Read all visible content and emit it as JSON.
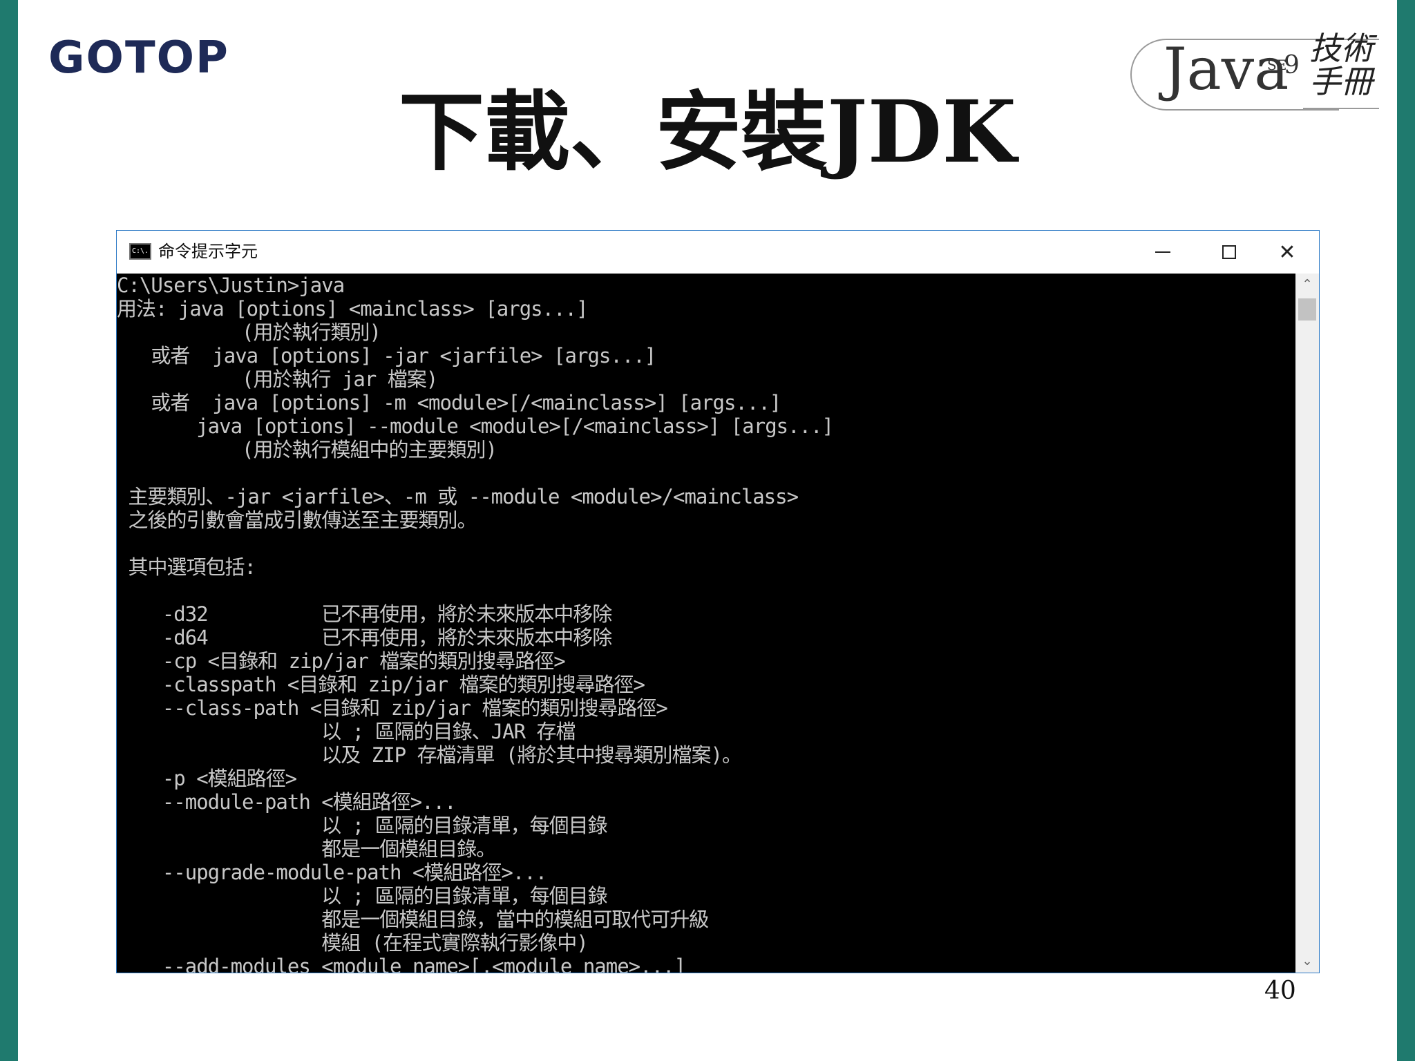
{
  "slide": {
    "brand_logo": "GOTOP",
    "badge_word": "Java",
    "badge_edition": "SE",
    "badge_version": "9",
    "badge_brush": "技術手冊",
    "title": "下載、安裝JDK",
    "page_number": "40"
  },
  "window": {
    "icon_label": "C:\\.",
    "title": "命令提示字元",
    "minimize_icon": "minimize-icon",
    "maximize_icon": "maximize-icon",
    "close_icon": "close-icon",
    "close_glyph": "✕"
  },
  "console": {
    "lines": [
      "C:\\Users\\Justin>java",
      "用法: java [options] <mainclass> [args...]",
      "           (用於執行類別)",
      "   或者  java [options] -jar <jarfile> [args...]",
      "           (用於執行 jar 檔案)",
      "   或者  java [options] -m <module>[/<mainclass>] [args...]",
      "       java [options] --module <module>[/<mainclass>] [args...]",
      "           (用於執行模組中的主要類別)",
      "",
      " 主要類別、-jar <jarfile>、-m 或 --module <module>/<mainclass>",
      " 之後的引數會當成引數傳送至主要類別。",
      "",
      " 其中選項包括:",
      "",
      "    -d32          已不再使用，將於未來版本中移除",
      "    -d64          已不再使用，將於未來版本中移除",
      "    -cp <目錄和 zip/jar 檔案的類別搜尋路徑>",
      "    -classpath <目錄和 zip/jar 檔案的類別搜尋路徑>",
      "    --class-path <目錄和 zip/jar 檔案的類別搜尋路徑>",
      "                  以 ; 區隔的目錄、JAR 存檔",
      "                  以及 ZIP 存檔清單 (將於其中搜尋類別檔案)。",
      "    -p <模組路徑>",
      "    --module-path <模組路徑>...",
      "                  以 ; 區隔的目錄清單，每個目錄",
      "                  都是一個模組目錄。",
      "    --upgrade-module-path <模組路徑>...",
      "                  以 ; 區隔的目錄清單，每個目錄",
      "                  都是一個模組目錄，當中的模組可取代可升級",
      "                  模組 (在程式實際執行影像中)",
      "    --add-modules <module name>[,<module name>...]"
    ]
  },
  "scrollbar": {
    "up_glyph": "⌃",
    "down_glyph": "⌄",
    "position": 0.0
  }
}
